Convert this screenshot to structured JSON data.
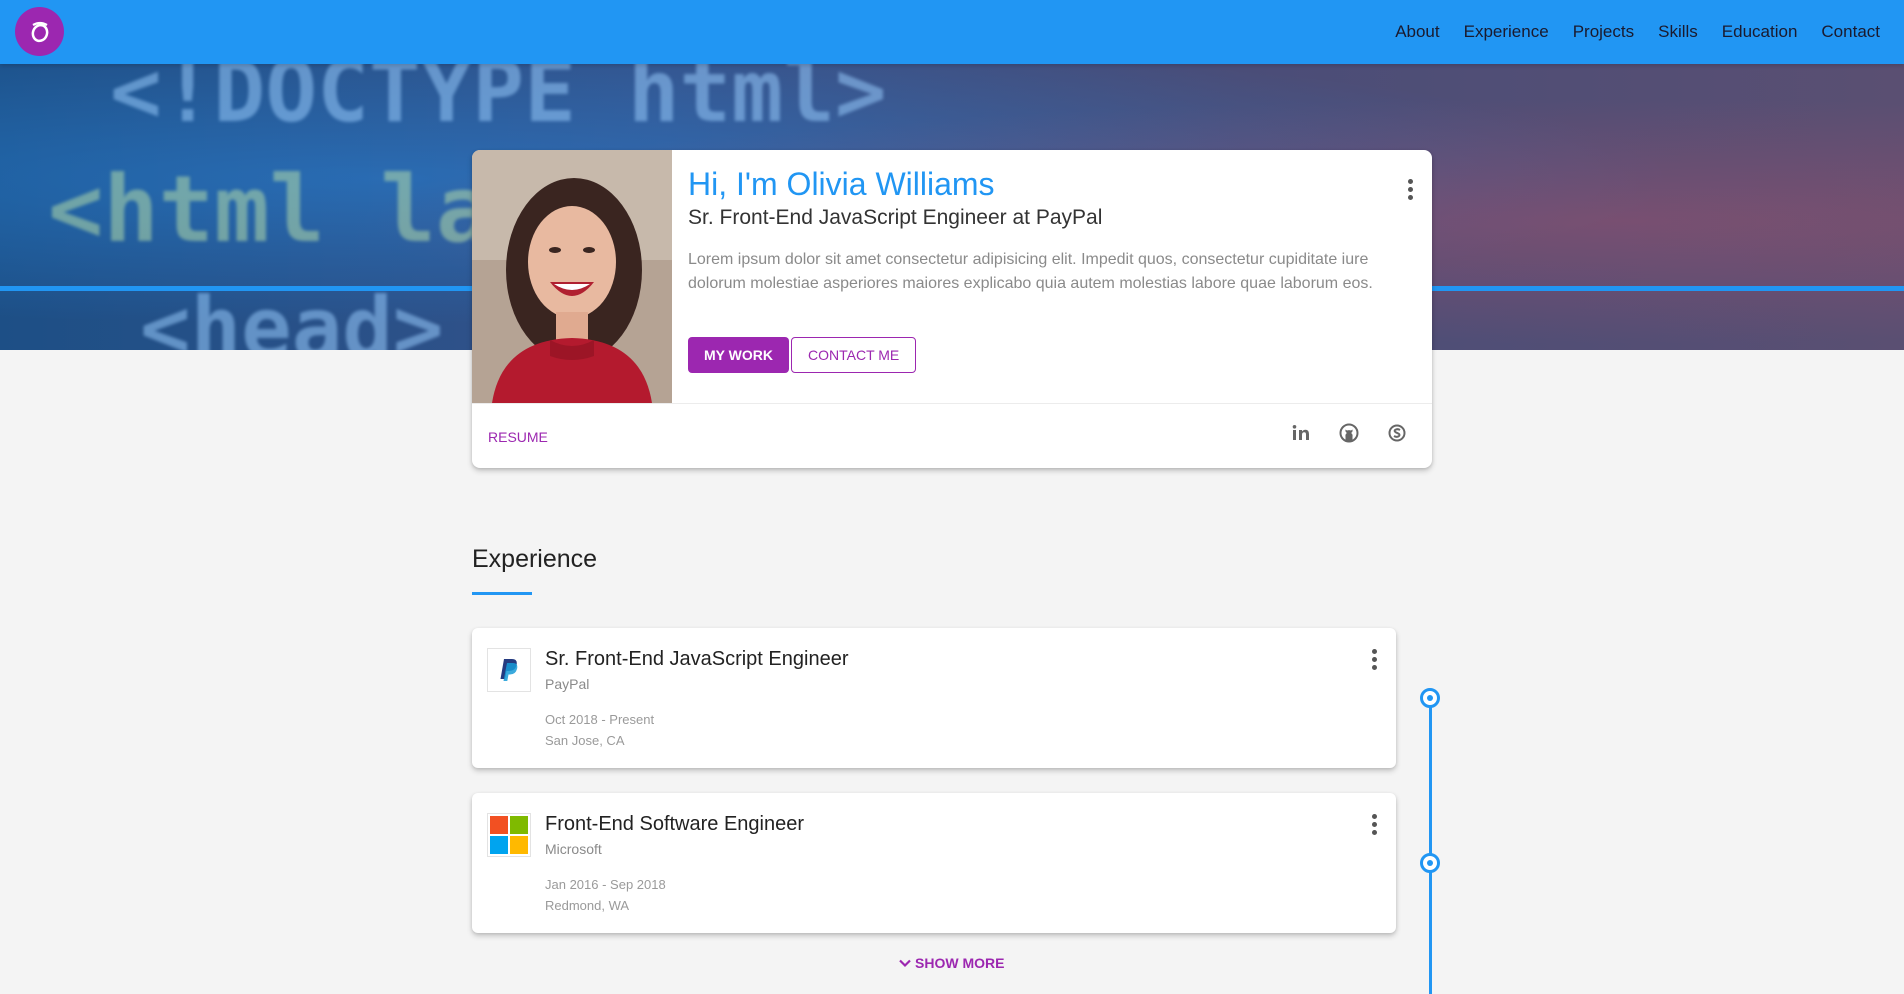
{
  "brand": {
    "logo_letter": "O",
    "accent": "#2196f3",
    "primary": "#9c27b0"
  },
  "nav": {
    "items": [
      {
        "label": "About"
      },
      {
        "label": "Experience"
      },
      {
        "label": "Projects"
      },
      {
        "label": "Skills"
      },
      {
        "label": "Education"
      },
      {
        "label": "Contact"
      }
    ]
  },
  "hero": {
    "code_lines": [
      "<!DOCTYPE html>",
      "<html lan",
      "<head>"
    ]
  },
  "profile": {
    "name": "Hi, I'm Olivia Williams",
    "role": "Sr. Front-End JavaScript Engineer at PayPal",
    "bio": "Lorem ipsum dolor sit amet consectetur adipisicing elit. Impedit quos, consectetur cupiditate iure dolorum molestiae asperiores maiores explicabo quia autem molestias labore quae laborum eos.",
    "primary_button": "My Work",
    "secondary_button": "Contact Me",
    "resume_label": "Resume",
    "social": [
      "linkedin-icon",
      "github-icon",
      "skype-icon"
    ]
  },
  "experience": {
    "title": "Experience",
    "items": [
      {
        "title": "Sr. Front-End JavaScript Engineer",
        "company": "PayPal",
        "dates": "Oct 2018 - Present",
        "location": "San Jose, CA",
        "logo": "paypal-logo"
      },
      {
        "title": "Front-End Software Engineer",
        "company": "Microsoft",
        "dates": "Jan 2016 - Sep 2018",
        "location": "Redmond, WA",
        "logo": "microsoft-logo"
      }
    ],
    "show_more_label": "Show More"
  }
}
